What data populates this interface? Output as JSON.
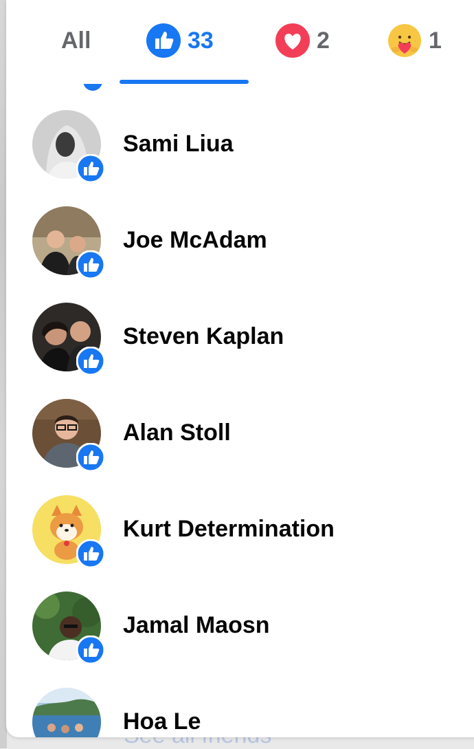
{
  "tabs": [
    {
      "label": "All",
      "count": "",
      "icon": "none",
      "active": false
    },
    {
      "label": "",
      "count": "33",
      "icon": "like-reaction-icon",
      "active": true
    },
    {
      "label": "",
      "count": "2",
      "icon": "love-reaction-icon",
      "active": false
    },
    {
      "label": "",
      "count": "1",
      "icon": "care-reaction-icon",
      "active": false
    }
  ],
  "people": [
    {
      "name": "Sami Liua",
      "reaction": "like"
    },
    {
      "name": "Joe McAdam",
      "reaction": "like"
    },
    {
      "name": "Steven Kaplan",
      "reaction": "like"
    },
    {
      "name": "Alan Stoll",
      "reaction": "like"
    },
    {
      "name": "Kurt Determination",
      "reaction": "like"
    },
    {
      "name": "Jamal Maosn",
      "reaction": "like"
    },
    {
      "name": "Hoa Le",
      "reaction": "like"
    }
  ],
  "background": {
    "link_text": "See all friends"
  },
  "colors": {
    "accent": "#1877f2",
    "love": "#f33e58",
    "text": "#050505",
    "muted": "#65676b"
  }
}
